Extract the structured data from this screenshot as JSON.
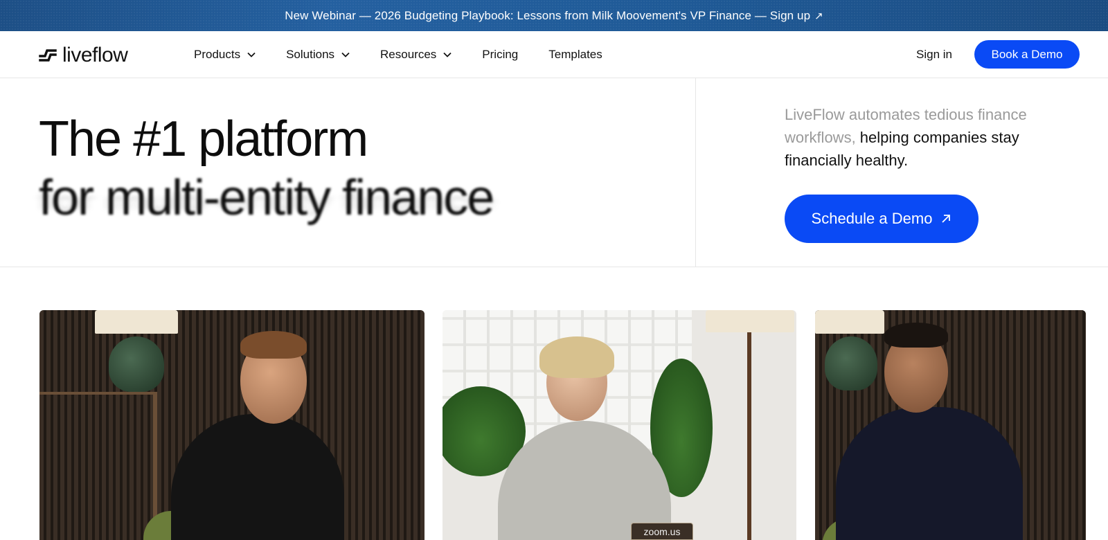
{
  "banner": {
    "text": "New Webinar — 2026 Budgeting Playbook: Lessons from Milk Moovement's VP Finance — Sign up",
    "arrow_icon": "arrow-up-right-icon"
  },
  "nav": {
    "logo_text": "liveflow",
    "items": [
      {
        "label": "Products",
        "has_dropdown": true
      },
      {
        "label": "Solutions",
        "has_dropdown": true
      },
      {
        "label": "Resources",
        "has_dropdown": true
      },
      {
        "label": "Pricing",
        "has_dropdown": false
      },
      {
        "label": "Templates",
        "has_dropdown": false
      }
    ],
    "sign_in": "Sign in",
    "book_demo": "Book a Demo"
  },
  "hero": {
    "headline_line1": "The #1 platform",
    "headline_line2": "for multi-entity finance",
    "lede_muted": "LiveFlow automates tedious finance workflows,",
    "lede_strong": " helping companies stay financially healthy.",
    "cta": "Schedule a Demo"
  },
  "media": {
    "zoom_label": "zoom.us"
  },
  "colors": {
    "accent": "#0a4af5",
    "banner": "#1f5a97"
  }
}
